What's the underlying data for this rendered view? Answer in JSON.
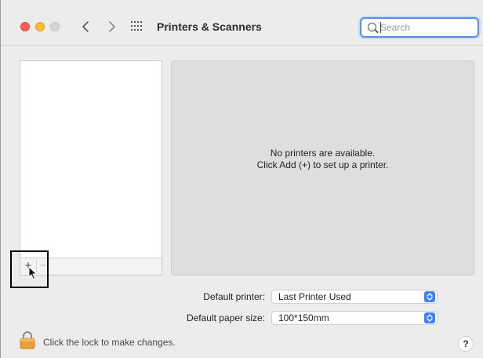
{
  "window": {
    "title": "Printers & Scanners",
    "nav": {
      "back_icon": "chevron-left-icon",
      "forward_icon": "chevron-right-icon",
      "grid_icon": "show-all-grid-icon"
    }
  },
  "search": {
    "placeholder": "Search",
    "value": ""
  },
  "printer_list": {
    "items": [],
    "add_label": "+",
    "remove_label": "−"
  },
  "detail": {
    "empty_line1": "No printers are available.",
    "empty_line2": "Click Add (+) to set up a printer."
  },
  "defaults": {
    "default_printer_label": "Default printer:",
    "default_printer_value": "Last Printer Used",
    "paper_size_label": "Default paper size:",
    "paper_size_value": "100*150mm"
  },
  "footer": {
    "lock_text": "Click the lock to make changes.",
    "help_label": "?"
  },
  "colors": {
    "close": "#ff5f57",
    "minimize": "#febc2e",
    "zoom": "#d6d6d6",
    "accent": "#3b82f6",
    "lock": "#e8a13a"
  }
}
